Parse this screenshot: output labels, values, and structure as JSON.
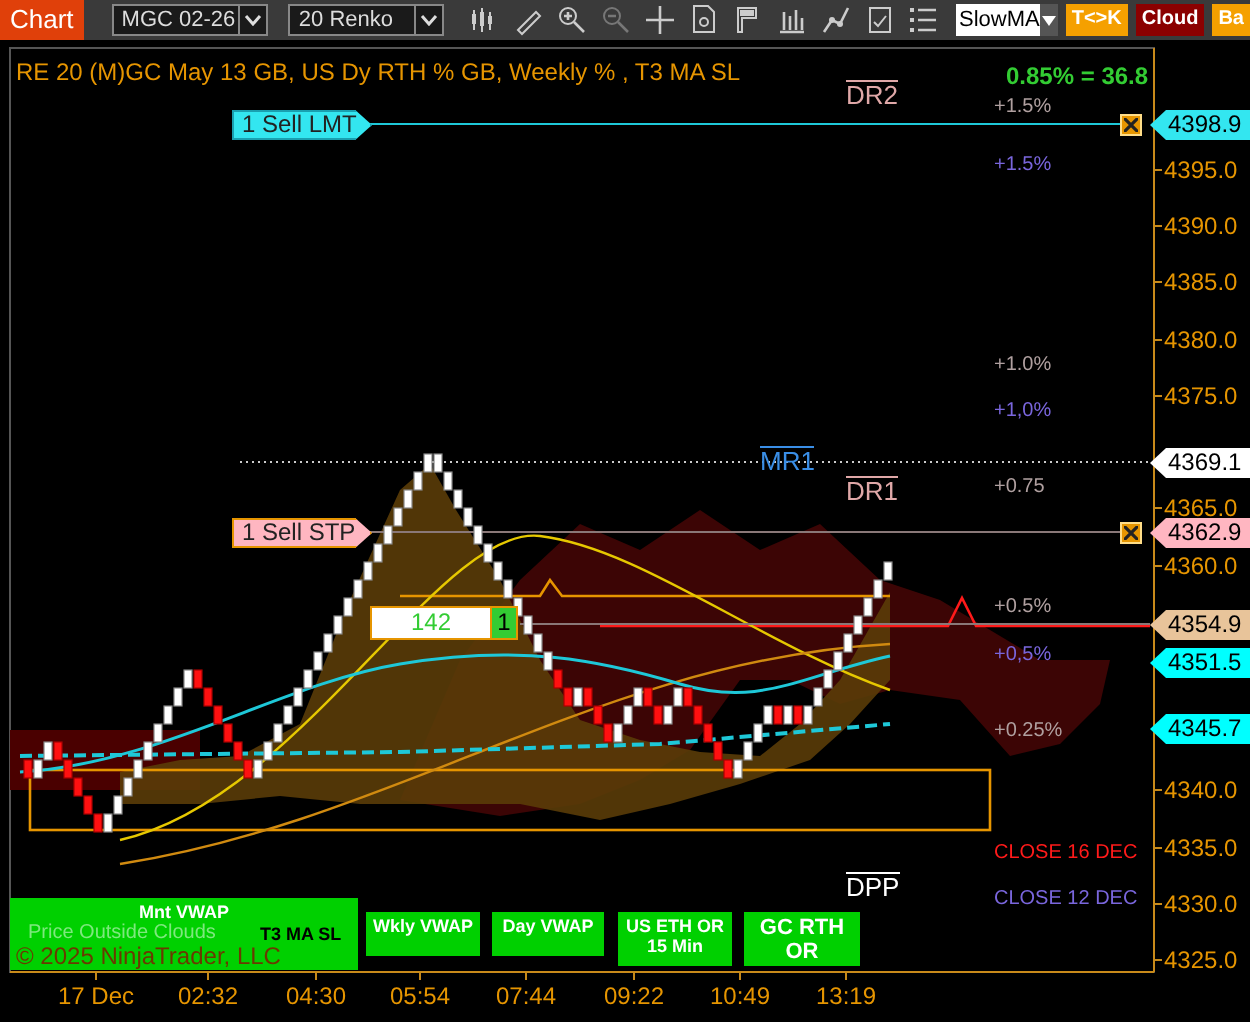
{
  "toolbar": {
    "title": "Chart",
    "instrument": "MGC 02-26",
    "bar_type": "20 Renko",
    "indicator_select": "SlowMA",
    "buttons": [
      {
        "label": "T<>K",
        "kind": "swap"
      },
      {
        "label": "Cloud",
        "kind": "cloud"
      },
      {
        "label": "Ba",
        "kind": "bar"
      }
    ]
  },
  "chart": {
    "header": "RE 20  (M)GC May 13 GB, US Dy RTH % GB, Weekly % , T3 MA SL",
    "change": "0.85% = 36.8",
    "orders": [
      {
        "label": "1 Sell LMT",
        "price": "4398.9",
        "kind": "limit"
      },
      {
        "label": "1 Sell STP",
        "price": "4362.9",
        "kind": "stop"
      }
    ],
    "position": {
      "pnl": "142",
      "quantity": "1"
    },
    "pivots": [
      {
        "label": "DR2",
        "color": "#e0a8a8"
      },
      {
        "label": "MR1",
        "color": "#3a8ee6"
      },
      {
        "label": "DR1",
        "color": "#e0a8a8"
      },
      {
        "label": "DPP",
        "color": "#ffffff"
      }
    ],
    "level_labels": [
      {
        "text": "+1.5%",
        "color": "#b0a0a0"
      },
      {
        "text": "+1.5%",
        "color": "#7a66dd"
      },
      {
        "text": "+1.0%",
        "color": "#b0a0a0"
      },
      {
        "text": "+1,0%",
        "color": "#7a66dd"
      },
      {
        "text": "+0.75",
        "color": "#b0a0a0"
      },
      {
        "text": "+0.5%",
        "color": "#b0a0a0"
      },
      {
        "text": "+0,5%",
        "color": "#7a66dd"
      },
      {
        "text": "+0.25%",
        "color": "#b0a0a0"
      },
      {
        "text": "CLOSE 16 DEC",
        "color": "#ff1a1a"
      },
      {
        "text": "CLOSE 12 DEC",
        "color": "#7a66dd"
      }
    ],
    "price_tags": [
      {
        "price": "4369.1",
        "color": "#ffffff"
      },
      {
        "price": "4354.9",
        "color": "#e8c49a"
      },
      {
        "price": "4351.5",
        "color": "#00ffff"
      },
      {
        "price": "4345.7",
        "color": "#00ffff"
      }
    ],
    "price_axis": [
      "4395.0",
      "4390.0",
      "4385.0",
      "4380.0",
      "4375.0",
      "4365.0",
      "4360.0",
      "4340.0",
      "4335.0",
      "4330.0",
      "4325.0"
    ],
    "time_axis": [
      "17 Dec",
      "02:32",
      "04:30",
      "05:54",
      "07:44",
      "09:22",
      "10:49",
      "13:19"
    ],
    "legend": [
      "Mnt VWAP",
      "Wkly VWAP",
      "Day VWAP",
      "US ETH OR 15 Min",
      "GC RTH OR"
    ],
    "overlay_texts": [
      "Price Outside Clouds",
      "T3 MA SL",
      "© 2025 NinjaTrader, LLC"
    ]
  }
}
